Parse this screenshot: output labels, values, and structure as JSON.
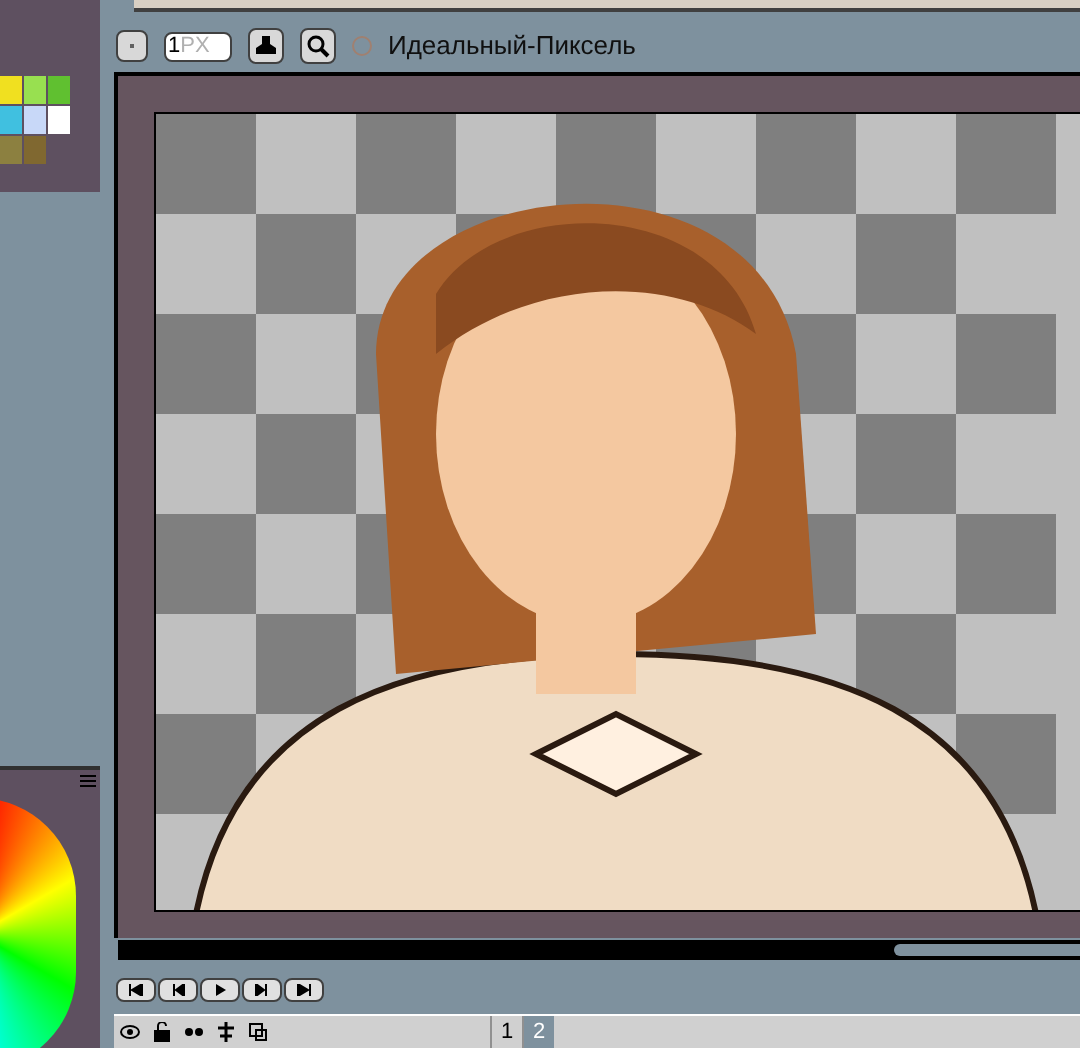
{
  "palette": [
    {
      "color": "#f0e020"
    },
    {
      "color": "#98e050"
    },
    {
      "color": "#60c030"
    },
    {
      "color": "#40c0e0"
    },
    {
      "color": "#c8d8f8"
    },
    {
      "color": "#ffffff"
    },
    {
      "color": "#8c8040"
    },
    {
      "color": "#806830"
    }
  ],
  "toolbar": {
    "brush_size": "1",
    "unit": "PX",
    "perfect_pixel": {
      "label": "Идеальный-Пиксель",
      "checked": false
    }
  },
  "pages": [
    {
      "label": "1",
      "selected": false
    },
    {
      "label": "2",
      "selected": true
    }
  ]
}
